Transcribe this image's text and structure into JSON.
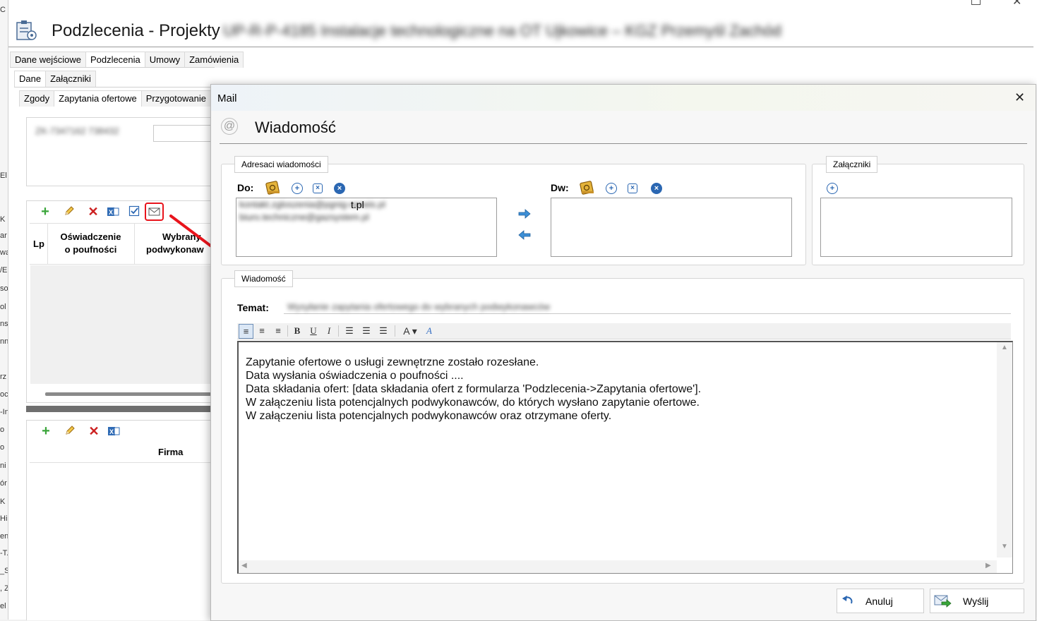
{
  "window": {
    "title": "Podzlecenia - Projekty",
    "title_blurred": "UP-R-P-4185 Instalacje technologiczne na OT Ujkowice – KGZ Przemyśl Zachód"
  },
  "main_tabs": [
    "Dane wejściowe",
    "Podzlecenia",
    "Umowy",
    "Zamówienia"
  ],
  "sub_tabs": [
    "Dane",
    "Załączniki"
  ],
  "inner_tabs": [
    "Zgody",
    "Zapytania ofertowe",
    "Przygotowanie"
  ],
  "left_form": {
    "blurred_field": "ZK-7347162 738432"
  },
  "grid1": {
    "col_lp": "Lp",
    "col_oswiadczenie": "Oświadczenie o poufności",
    "col_wybrany": "Wybrany podwykonawca",
    "col_oswiadczenie_l1": "Oświadczenie",
    "col_oswiadczenie_l2": "o poufności",
    "col_wybrany_l1": "Wybrany",
    "col_wybrany_l2": "podwykonaw"
  },
  "grid2": {
    "col_firma": "Firma"
  },
  "left_strip_letters": [
    "C",
    "El",
    "K",
    "ar",
    "wa",
    "/E",
    "so",
    "ol",
    "ns",
    "nn",
    "rz",
    "oc",
    "-In",
    "o",
    "o",
    "ni",
    "ór",
    "K",
    "Hi",
    "en",
    "-T.",
    "_Si",
    ", Z",
    "el"
  ],
  "modal": {
    "title": "Mail",
    "heading": "Wiadomość",
    "recipients_group": "Adresaci wiadomości",
    "to_label": "Do:",
    "cc_label": "Dw:",
    "to_addresses": [
      "kontakt.zgloszenia@pgnig-serwis.pl",
      "biuro.techniczne@gazsystem.pl"
    ],
    "to_visible_suffix": "t.pl",
    "attachments_group": "Załączniki",
    "message_group": "Wiadomość",
    "subject_label": "Temat:",
    "subject_value": "Wysyłanie zapytania ofertowego do wybranych podwykonawców",
    "body_lines": [
      "Zapytanie ofertowe o usługi zewnętrzne zostało rozesłane.",
      "Data wysłania oświadczenia o poufności ....",
      "Data składania ofert: [data składania ofert z formularza 'Podzlecenia->Zapytania ofertowe'].",
      "W załączeniu lista potencjalnych podwykonawców, do których wysłano zapytanie ofertowe.",
      "W załączeniu lista potencjalnych podwykonawców oraz otrzymane oferty."
    ],
    "cancel_label": "Anuluj",
    "send_label": "Wyślij"
  },
  "icons": {
    "address_book": "address-book-icon",
    "add": "add-circle-icon",
    "remove": "remove-square-icon",
    "clear": "clear-circle-icon",
    "arrow_right": "arrow-right-icon",
    "arrow_left": "arrow-left-icon"
  },
  "colors": {
    "accent": "#2b67b2",
    "annotation_red": "#e8141c",
    "add_green": "#3aa53a",
    "delete_red": "#cc2020"
  }
}
